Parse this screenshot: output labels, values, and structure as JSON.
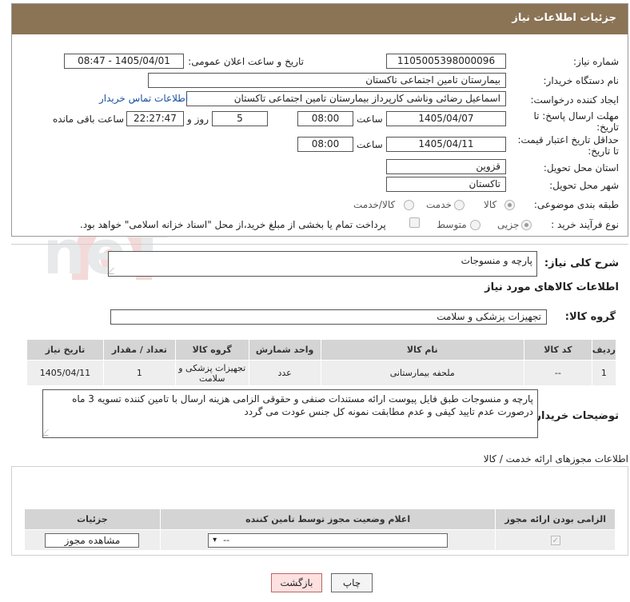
{
  "header": {
    "title": "جزئیات اطلاعات نیاز"
  },
  "form": {
    "need_number_label": "شماره نیاز:",
    "need_number": "1105005398000096",
    "announce_label": "تاریخ و ساعت اعلان عمومی:",
    "announce_value": "1405/04/01 - 08:47",
    "buyer_org_label": "نام دستگاه خریدار:",
    "buyer_org": "بیمارستان تامین اجتماعی تاکستان",
    "requester_label": "ایجاد کننده درخواست:",
    "requester": "اسماعیل رضائی وناشی کارپرداز بیمارستان تامین اجتماعی تاکستان",
    "contact_link": "اطلاعات تماس خریدار",
    "reply_deadline_label_1": "مهلت ارسال پاسخ: تا",
    "reply_deadline_label_2": "تاریخ:",
    "reply_date": "1405/04/07",
    "time_label": "ساعت",
    "reply_time": "08:00",
    "days_value": "5",
    "days_label": "روز و",
    "remaining_time": "22:27:47",
    "remaining_label": "ساعت باقی مانده",
    "price_validity_label_1": "حداقل تاریخ اعتبار قیمت:",
    "price_validity_label_2": "تا تاریخ:",
    "price_date": "1405/04/11",
    "price_time": "08:00",
    "province_label": "استان محل تحویل:",
    "province": "قزوین",
    "city_label": "شهر محل تحویل:",
    "city": "تاکستان",
    "category_label": "طبقه بندی موضوعی:",
    "category_options": [
      "کالا",
      "خدمت",
      "کالا/خدمت"
    ],
    "process_label": "نوع فرآیند خرید :",
    "process_options": [
      "جزیی",
      "متوسط"
    ],
    "payment_note": "پرداخت تمام یا بخشی از مبلغ خرید،از محل \"اسناد خزانه اسلامی\" خواهد بود."
  },
  "description": {
    "label": "شرح کلی نیاز:",
    "value": "پارچه و منسوجات"
  },
  "goods": {
    "section_title": "اطلاعات کالاهای مورد نیاز",
    "group_label": "گروه کالا:",
    "group_value": "تجهیزات پزشکی و سلامت",
    "table_headers": [
      "ردیف",
      "کد کالا",
      "نام کالا",
      "واحد شمارش",
      "گروه کالا",
      "تعداد / مقدار",
      "تاریخ نیاز"
    ],
    "rows": [
      [
        "1",
        "--",
        "ملحفه بیمارستانی",
        "عدد",
        "تجهیزات پزشکی و سلامت",
        "1",
        "1405/04/11"
      ]
    ],
    "buyer_notes_label": "توضیحات خریدار:",
    "buyer_notes": "پارچه و منسوجات طبق فایل پیوست  ارائه مستندات صنفی و حقوقی الزامی هزینه ارسال با تامین کننده تسویه 3 ماه درصورت عدم تایید کیفی و عدم مطابقت نمونه کل جنس عودت می گردد"
  },
  "permits": {
    "title": "اطلاعات مجوزهای ارائه خدمت / کالا",
    "headers": [
      "الزامی بودن ارائه مجوز",
      "اعلام وضعیت مجوز توسط تامین کننده",
      "جزئیات"
    ],
    "select_value": "--",
    "view_button": "مشاهده مجوز"
  },
  "actions": {
    "print": "چاپ",
    "back": "بازگشت"
  },
  "watermark": {
    "text": "AriaTender.neT"
  }
}
